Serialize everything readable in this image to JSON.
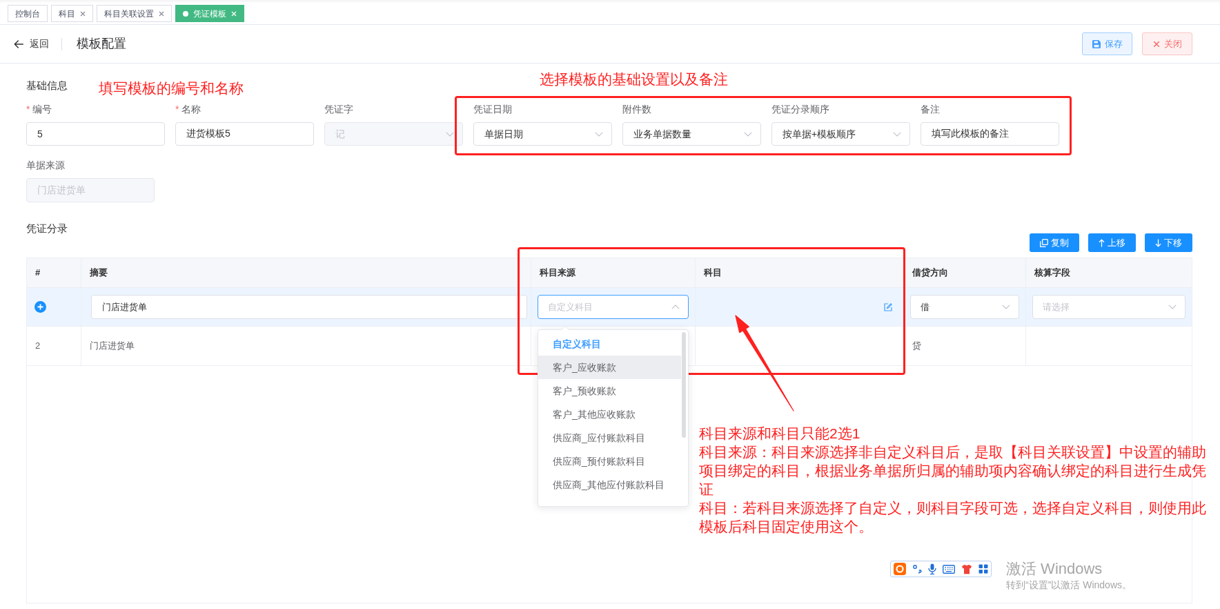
{
  "tabs": [
    {
      "label": "控制台",
      "closable": false,
      "selected": false
    },
    {
      "label": "科目",
      "closable": true,
      "selected": false
    },
    {
      "label": "科目关联设置",
      "closable": true,
      "selected": false
    },
    {
      "label": "凭证模板",
      "closable": true,
      "selected": true
    }
  ],
  "header": {
    "back_label": "返回",
    "title": "模板配置",
    "buttons": [
      {
        "label": "保存",
        "kind": "save"
      },
      {
        "label": "关闭",
        "kind": "close"
      }
    ]
  },
  "basic_info": {
    "heading": "基础信息",
    "rows": [
      [
        {
          "label": "编号",
          "required_mark": "*",
          "kind": "input",
          "value": "5",
          "disabled": false
        },
        {
          "label": "名称",
          "required_mark": "*",
          "kind": "input",
          "value": "进货模板5",
          "disabled": false
        },
        {
          "label": "凭证字",
          "kind": "select",
          "value": "记",
          "disabled": true
        },
        {
          "label": "凭证日期",
          "kind": "select",
          "value": "单据日期",
          "disabled": false
        },
        {
          "label": "附件数",
          "kind": "select",
          "value": "业务单据数量",
          "disabled": false
        },
        {
          "label": "凭证分录顺序",
          "kind": "select",
          "value": "按单据+模板顺序",
          "disabled": false
        },
        {
          "label": "备注",
          "kind": "input",
          "value": "填写此模板的备注",
          "disabled": false
        }
      ],
      [
        {
          "label": "单据来源",
          "kind": "input",
          "value": "门店进货单",
          "disabled": true
        }
      ]
    ]
  },
  "entries": {
    "heading": "凭证分录",
    "buttons": [
      {
        "label": "复制",
        "kind": "copy"
      },
      {
        "label": "上移",
        "kind": "up"
      },
      {
        "label": "下移",
        "kind": "down"
      }
    ],
    "columns": [
      "#",
      "摘要",
      "科目来源",
      "科目",
      "借贷方向",
      "核算字段"
    ],
    "rows": [
      {
        "editing": true,
        "summary": "门店进货单",
        "subject_source": {
          "placeholder": "自定义科目",
          "open": true,
          "options": [
            {
              "label": "自定义科目",
              "selected": true,
              "hovered": false
            },
            {
              "label": "客户_应收账款",
              "selected": false,
              "hovered": true
            },
            {
              "label": "客户_预收账款",
              "selected": false,
              "hovered": false
            },
            {
              "label": "客户_其他应收账款",
              "selected": false,
              "hovered": false
            },
            {
              "label": "供应商_应付账款科目",
              "selected": false,
              "hovered": false
            },
            {
              "label": "供应商_预付账款科目",
              "selected": false,
              "hovered": false
            },
            {
              "label": "供应商_其他应付账款科目",
              "selected": false,
              "hovered": false
            }
          ]
        },
        "direction": {
          "value": "借"
        },
        "accounting_field": {
          "placeholder": "请选择"
        }
      },
      {
        "editing": false,
        "number": "2",
        "summary": "门店进货单",
        "direction": "贷"
      }
    ]
  },
  "annotations": {
    "labels": [
      "填写模板的编号和名称",
      "选择模板的基础设置以及备注"
    ],
    "notes": [
      "科目来源和科目只能2选1",
      "科目来源：科目来源选择非自定义科目后，是取【科目关联设置】中设置的辅助项目绑定的科目，根据业务单据所归属的辅助项内容确认绑定的科目进行生成凭证",
      "科目：若科目来源选择了自定义，则科目字段可选，选择自定义科目，则使用此模板后科目固定使用这个。"
    ]
  },
  "system_overlay": {
    "watermark_title": "激活 Windows",
    "watermark_hint": "转到“设置”以激活 Windows。"
  }
}
